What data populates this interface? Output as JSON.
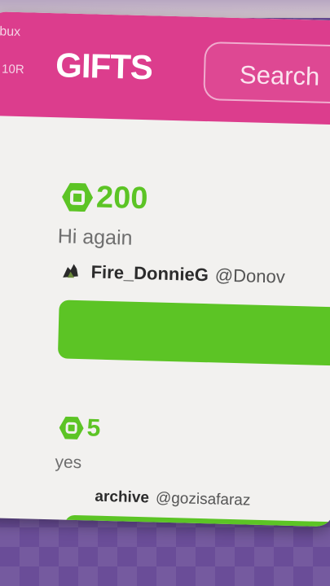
{
  "header": {
    "robux_label": "bux",
    "robux_amount": "10R",
    "title": "GIFTS",
    "search_label": "Search"
  },
  "gifts": [
    {
      "amount": "200",
      "message": "Hi again",
      "display_name": "Fire_DonnieG",
      "handle": "@Donov"
    },
    {
      "amount": "5",
      "message": "yes",
      "display_name": "archive",
      "handle": "@gozisafaraz"
    }
  ],
  "colors": {
    "brand_pink": "#dc3d8d",
    "robux_green": "#5cc425",
    "card_bg": "#f2f1ef"
  }
}
